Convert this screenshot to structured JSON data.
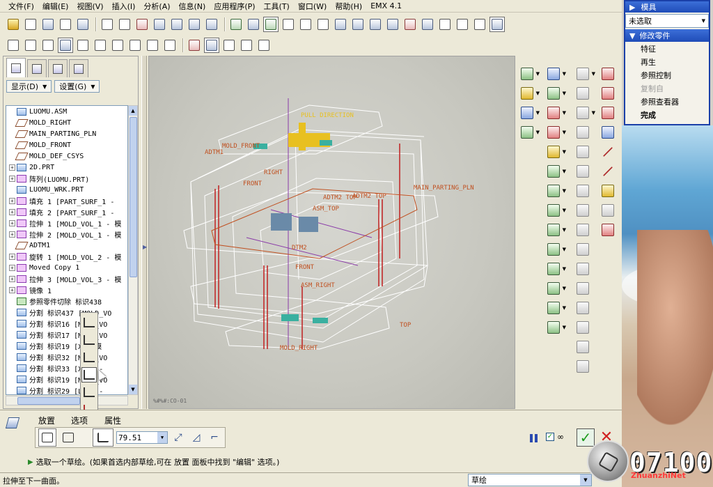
{
  "menubar": {
    "items": [
      "文件(F)",
      "编辑(E)",
      "视图(V)",
      "插入(I)",
      "分析(A)",
      "信息(N)",
      "应用程序(P)",
      "工具(T)",
      "窗口(W)",
      "帮助(H)",
      "EMX 4.1"
    ]
  },
  "tree": {
    "display_button": "显示(D)",
    "settings_button": "设置(G)",
    "rows": [
      {
        "label": "LUOMU.ASM",
        "icon": "assembly-icon",
        "expand": false
      },
      {
        "label": "MOLD_RIGHT",
        "icon": "datum-plane-icon",
        "expand": false
      },
      {
        "label": "MAIN_PARTING_PLN",
        "icon": "datum-plane-icon",
        "expand": false
      },
      {
        "label": "MOLD_FRONT",
        "icon": "datum-plane-icon",
        "expand": false
      },
      {
        "label": "MOLD_DEF_CSYS",
        "icon": "csys-icon",
        "expand": false
      },
      {
        "label": "2D.PRT",
        "icon": "part-icon",
        "expand": true
      },
      {
        "label": "阵列(LUOMU.PRT)",
        "icon": "pattern-icon",
        "expand": true
      },
      {
        "label": "LUOMU_WRK.PRT",
        "icon": "part-icon",
        "expand": false
      },
      {
        "label": "填充 1 [PART_SURF_1 - ",
        "icon": "fill-icon",
        "expand": true
      },
      {
        "label": "填充 2 [PART_SURF_1 - ",
        "icon": "fill-icon",
        "expand": true
      },
      {
        "label": "拉伸 1 [MOLD_VOL_1 - 模",
        "icon": "extrude-icon",
        "expand": true
      },
      {
        "label": "拉伸 2 [MOLD_VOL_1 - 模",
        "icon": "extrude-icon",
        "expand": true
      },
      {
        "label": "ADTM1",
        "icon": "datum-plane-icon",
        "expand": false
      },
      {
        "label": "旋转 1 [MOLD_VOL_2 - 模",
        "icon": "revolve-icon",
        "expand": true
      },
      {
        "label": "Moved Copy 1",
        "icon": "copy-icon",
        "expand": true
      },
      {
        "label": "拉伸 3 [MOLD_VOL_3 - 模",
        "icon": "extrude-icon",
        "expand": true
      },
      {
        "label": "镜像 1",
        "icon": "mirror-icon",
        "expand": true
      },
      {
        "label": "参照零件切除 标识438",
        "icon": "cut-icon",
        "expand": false
      },
      {
        "label": "分割 标识437 [MOLD_VO",
        "icon": "split-icon",
        "expand": false
      },
      {
        "label": "分割 标识16 [MOLD_VO",
        "icon": "split-icon",
        "expand": false
      },
      {
        "label": "分割 标识17 [MOLD_VO",
        "icon": "split-icon",
        "expand": false
      },
      {
        "label": "分割 标识19 [X - 模",
        "icon": "split-icon",
        "expand": false
      },
      {
        "label": "分割 标识32 [MOLD_VO",
        "icon": "split-icon",
        "expand": false
      },
      {
        "label": "分割 标识33 [X-02 -",
        "icon": "split-icon",
        "expand": false
      },
      {
        "label": "分割 标识19 [MOLD_VO",
        "icon": "split-icon",
        "expand": false
      },
      {
        "label": "分割 标识29 [L-01 -",
        "icon": "split-icon",
        "expand": false
      }
    ]
  },
  "graphics": {
    "labels": {
      "pull_direction": "PULL DIRECTION",
      "mold_front": "MOLD_FRONT",
      "adtm1": "ADTM1",
      "right": "RIGHT",
      "front": "FRONT",
      "main_parting": "MAIN_PARTING_PLN",
      "adtm2_top": "ADTM2 TOP",
      "adtm_top2": "ADTM2 TOP",
      "asm_top": "ASM_TOP",
      "top": "TOP",
      "mold_right": "MOLD_RIGHT",
      "asm_right": "ASM_RIGHT",
      "front2": "FRONT",
      "dtm2": "DTM2"
    },
    "status_code": "%#%#:CO-01"
  },
  "dashboard": {
    "tabs": {
      "placement": "放置",
      "options": "选项",
      "properties": "属性"
    },
    "depth_value": "79.51",
    "message": "选取一个草绘。(如果首选内部草绘,可在 放置 面板中找到 \"编辑\" 选项。)"
  },
  "statusbar": {
    "text": "拉伸至下一曲面。",
    "filter": "草绘"
  },
  "menu_manager": {
    "title": "模具",
    "selection": "未选取",
    "submenu_title": "修改零件",
    "items": [
      {
        "label": "特征",
        "state": "normal"
      },
      {
        "label": "再生",
        "state": "normal"
      },
      {
        "label": "参照控制",
        "state": "normal"
      },
      {
        "label": "复制自",
        "state": "disabled"
      },
      {
        "label": "参照查看器",
        "state": "normal"
      },
      {
        "label": "完成",
        "state": "bold"
      }
    ]
  },
  "overlay": {
    "counter": "07100",
    "watermark": "ZhuanzhiNet"
  },
  "colors": {
    "accent": "#1f4cb8",
    "datum_label": "#c05020",
    "pull_label": "#e8c020",
    "ok_green": "#1a9a1a",
    "cancel_red": "#d02020"
  }
}
